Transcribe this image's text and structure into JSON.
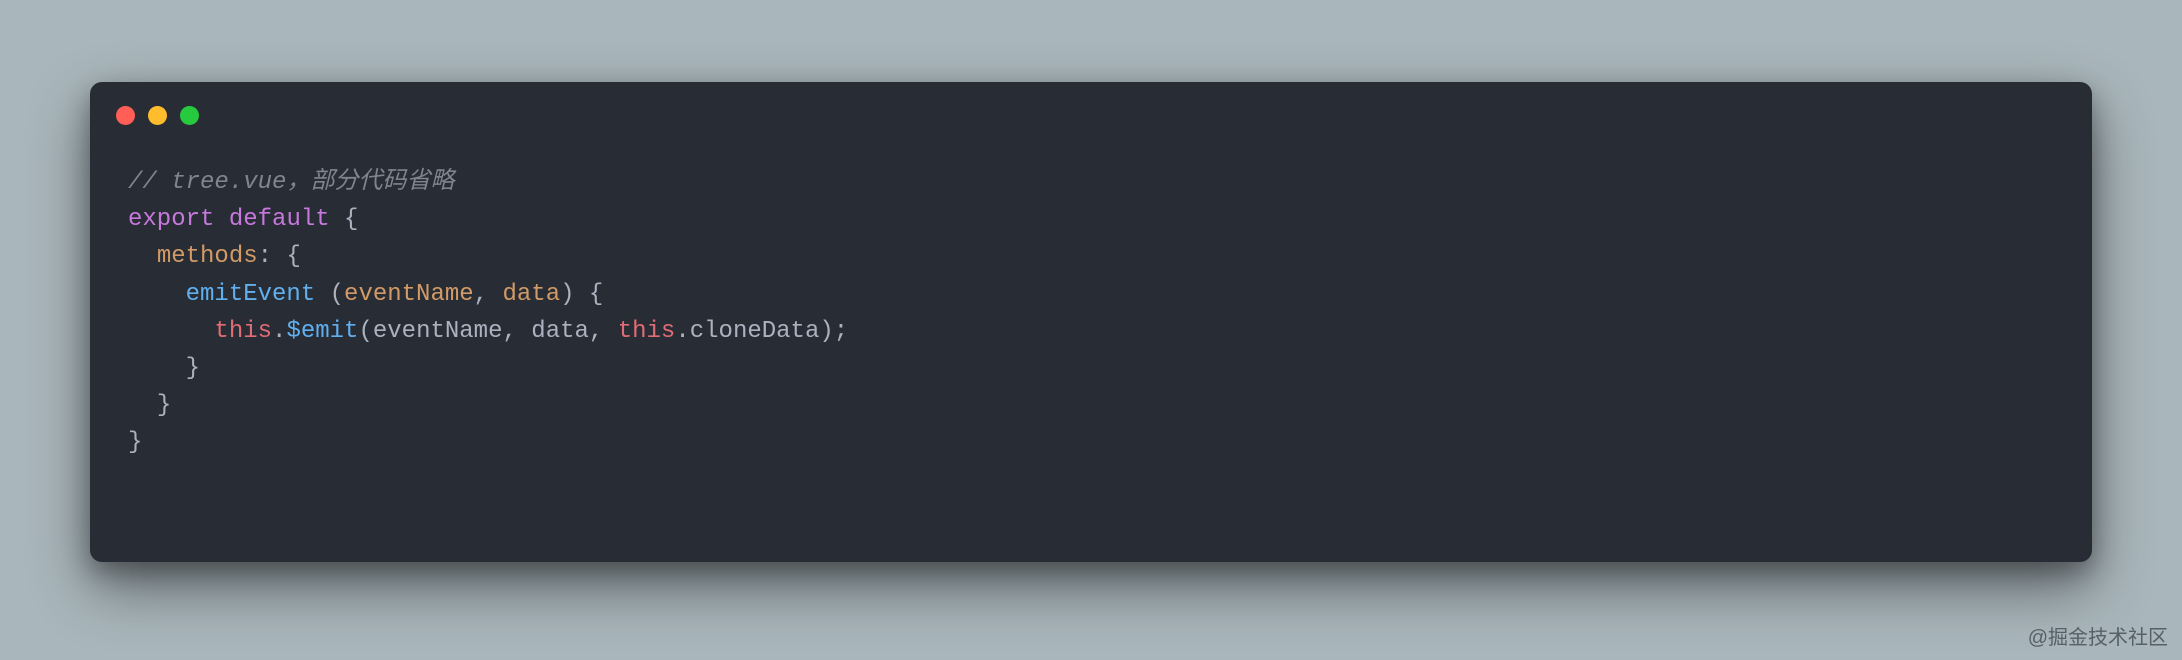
{
  "code": {
    "comment_prefix": "// ",
    "comment_file": "tree.vue",
    "comment_sep": "，",
    "comment_rest": "部分代码省略",
    "kw_export": "export",
    "kw_default": "default",
    "kw_this1": "this",
    "kw_this2": "this",
    "brace_open": " {",
    "brace_close1": "}",
    "brace_close2": "}",
    "brace_close3": "}",
    "methods_label": "methods",
    "colon_brace": ": {",
    "fn_name": "emitEvent",
    "fn_params_open": " (",
    "param_event": "eventName",
    "param_comma1": ", ",
    "param_data": "data",
    "fn_params_close": ") {",
    "dot1": ".",
    "emit_call": "$emit",
    "args_open": "(",
    "arg1": "eventName",
    "arg_comma1": ", ",
    "arg2": "data",
    "arg_comma2": ", ",
    "dot2": ".",
    "clone_prop": "cloneData",
    "args_close": ");",
    "indent1": "  ",
    "indent2": "    ",
    "indent3": "      "
  },
  "watermark": "@掘金技术社区"
}
